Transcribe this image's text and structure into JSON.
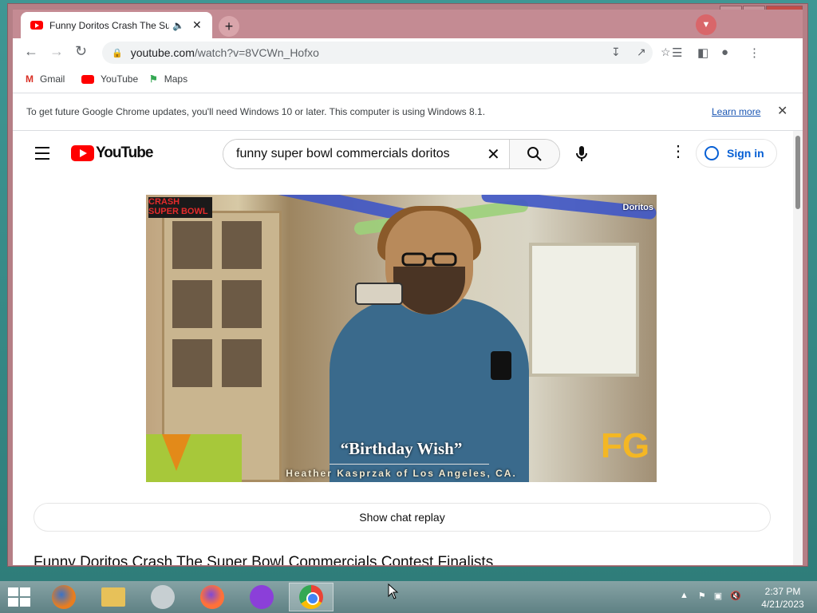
{
  "browser": {
    "tab": {
      "title": "Funny Doritos Crash The Super Bowl Commercials Contest Finalists",
      "close_icon": "close-icon"
    },
    "url_host": "youtube.com",
    "url_path": "/watch?v=8VCWn_Hofxo",
    "bookmarks": [
      {
        "label": "Gmail"
      },
      {
        "label": "YouTube"
      },
      {
        "label": "Maps"
      }
    ],
    "infobar": {
      "message": "To get future Google Chrome updates, you'll need Windows 10 or later. This computer is using Windows 8.1.",
      "link": "Learn more"
    }
  },
  "youtube": {
    "logo_text": "YouTube",
    "search_value": "funny super bowl commercials doritos",
    "sign_in": "Sign in",
    "video": {
      "caption_title": "“Birthday Wish”",
      "caption_author": "Heather Kasprzak of Los Angeles, CA.",
      "corner_logo_left": "CRASH SUPER BOWL",
      "corner_logo_right": "Doritos",
      "corner_badge": "FG"
    },
    "chat_replay": "Show chat replay",
    "video_title": "Funny Doritos Crash The Super Bowl Commercials Contest Finalists"
  },
  "taskbar": {
    "time": "2:37 PM",
    "date": "4/21/2023"
  },
  "colors": {
    "window_frame": "#b57f86",
    "youtube_red": "#ff0000",
    "link_blue": "#065fd4",
    "desktop": "#3f9794"
  }
}
